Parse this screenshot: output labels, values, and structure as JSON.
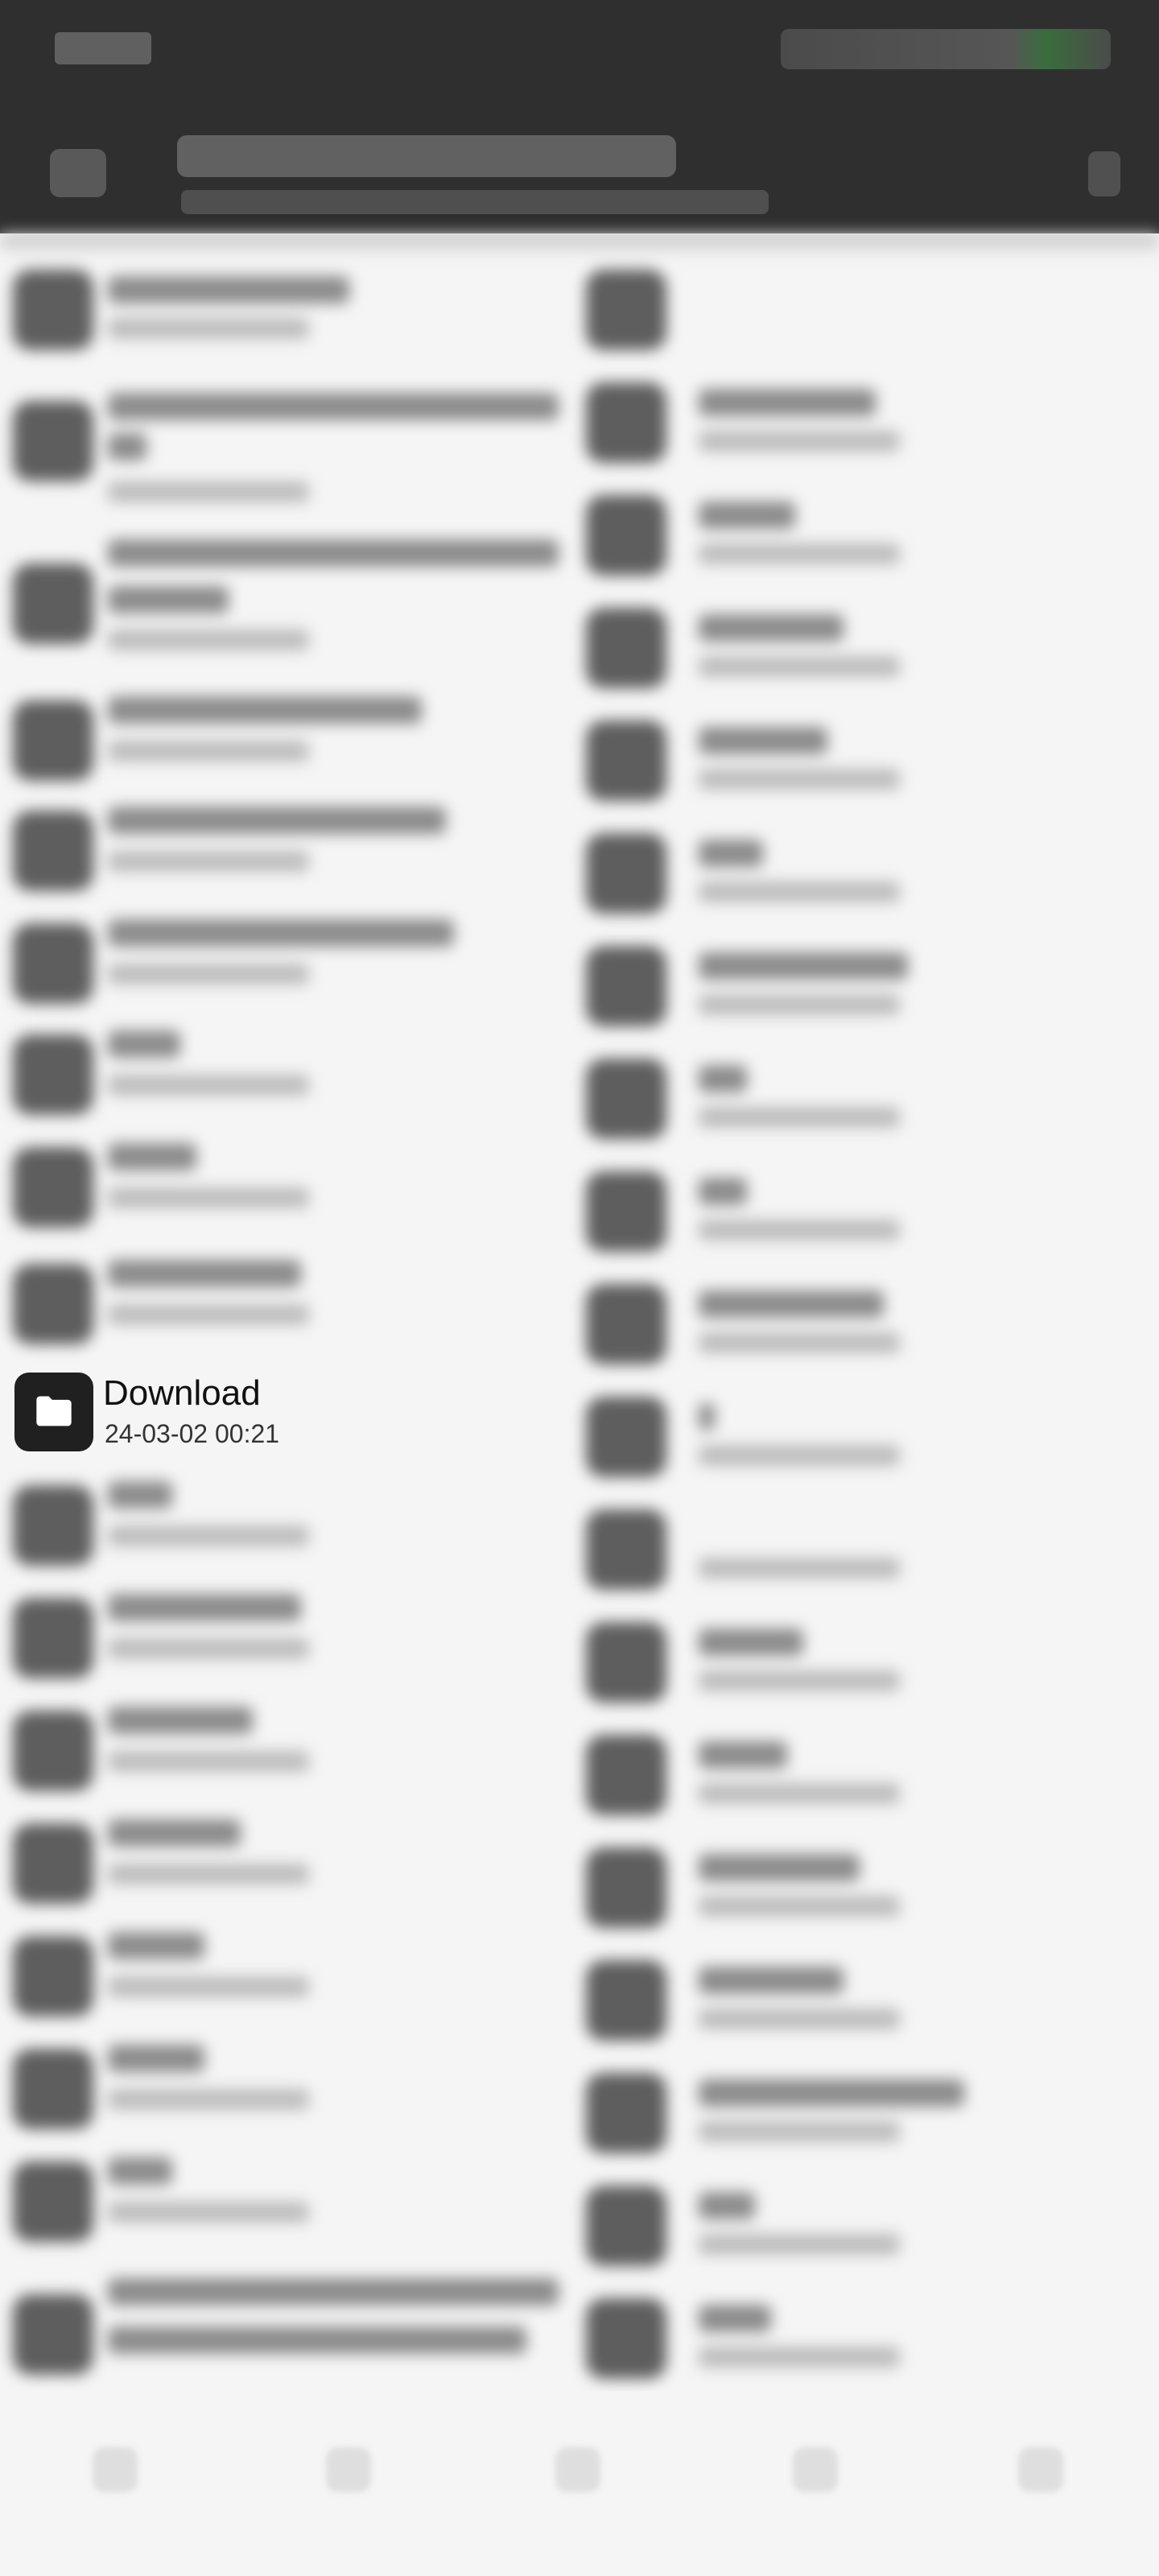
{
  "header": {
    "status_time_icon": "time-blurred",
    "status_icons": [
      "signal-icon",
      "wifi-icon",
      "battery-icon"
    ],
    "menu_icon": "menu-icon",
    "title_blurred": true,
    "more_icon": "more-icon"
  },
  "list": {
    "focused_item": {
      "name": "Download",
      "date": "24-03-02 00:21",
      "icon": "folder-icon"
    }
  },
  "bottom_nav": {
    "icons": [
      "nav-icon-1",
      "nav-icon-2",
      "nav-icon-3",
      "nav-icon-4",
      "nav-icon-5"
    ]
  }
}
